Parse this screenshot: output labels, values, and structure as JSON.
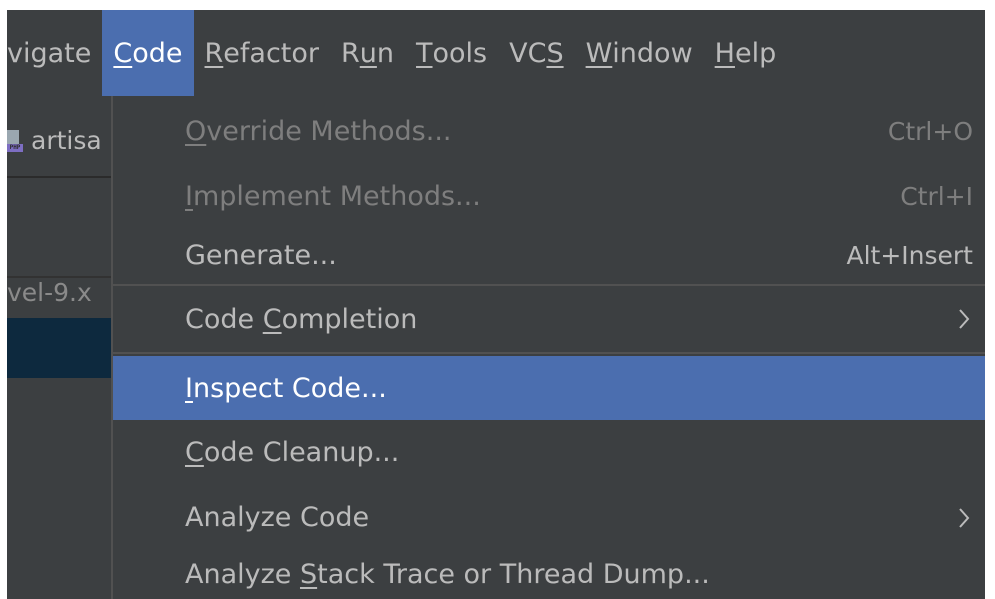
{
  "menubar": {
    "items": [
      {
        "label_pre": "",
        "mnemonic": "",
        "label_post": "vigate",
        "active": false
      },
      {
        "label_pre": "",
        "mnemonic": "C",
        "label_post": "ode",
        "active": true
      },
      {
        "label_pre": "",
        "mnemonic": "R",
        "label_post": "efactor",
        "active": false
      },
      {
        "label_pre": "R",
        "mnemonic": "u",
        "label_post": "n",
        "active": false
      },
      {
        "label_pre": "",
        "mnemonic": "T",
        "label_post": "ools",
        "active": false
      },
      {
        "label_pre": "VC",
        "mnemonic": "S",
        "label_post": "",
        "active": false
      },
      {
        "label_pre": "",
        "mnemonic": "W",
        "label_post": "indow",
        "active": false
      },
      {
        "label_pre": "",
        "mnemonic": "H",
        "label_post": "elp",
        "active": false
      }
    ]
  },
  "side": {
    "tab_label": "artisa",
    "file_badge": "PHP",
    "path_label": "vel-9.x"
  },
  "dropdown": {
    "items": [
      {
        "id": "override-methods",
        "label_pre": "",
        "mnemonic": "O",
        "label_post": "verride Methods...",
        "shortcut": "Ctrl+O",
        "enabled": false,
        "submenu": false,
        "highlight": false
      },
      {
        "id": "implement-methods",
        "label_pre": "",
        "mnemonic": "I",
        "label_post": "mplement Methods...",
        "shortcut": "Ctrl+I",
        "enabled": false,
        "submenu": false,
        "highlight": false
      },
      {
        "id": "generate",
        "label_pre": "Generate...",
        "mnemonic": "",
        "label_post": "",
        "shortcut": "Alt+Insert",
        "enabled": true,
        "submenu": false,
        "highlight": false
      },
      {
        "id": "code-completion",
        "label_pre": "Code ",
        "mnemonic": "C",
        "label_post": "ompletion",
        "shortcut": "",
        "enabled": true,
        "submenu": true,
        "highlight": false
      },
      {
        "id": "inspect-code",
        "label_pre": "",
        "mnemonic": "I",
        "label_post": "nspect Code...",
        "shortcut": "",
        "enabled": true,
        "submenu": false,
        "highlight": true
      },
      {
        "id": "code-cleanup",
        "label_pre": "",
        "mnemonic": "C",
        "label_post": "ode Cleanup...",
        "shortcut": "",
        "enabled": true,
        "submenu": false,
        "highlight": false
      },
      {
        "id": "analyze-code",
        "label_pre": "Analyze Code",
        "mnemonic": "",
        "label_post": "",
        "shortcut": "",
        "enabled": true,
        "submenu": true,
        "highlight": false
      },
      {
        "id": "analyze-stack-trace",
        "label_pre": "Analyze ",
        "mnemonic": "S",
        "label_post": "tack Trace or Thread Dump...",
        "shortcut": "",
        "enabled": true,
        "submenu": false,
        "highlight": false
      }
    ]
  },
  "colors": {
    "background": "#3c3f41",
    "highlight": "#4b6eaf",
    "text": "#bbbbbb",
    "disabled_text": "#7e7e7e",
    "selection_dark": "#0d293e"
  }
}
